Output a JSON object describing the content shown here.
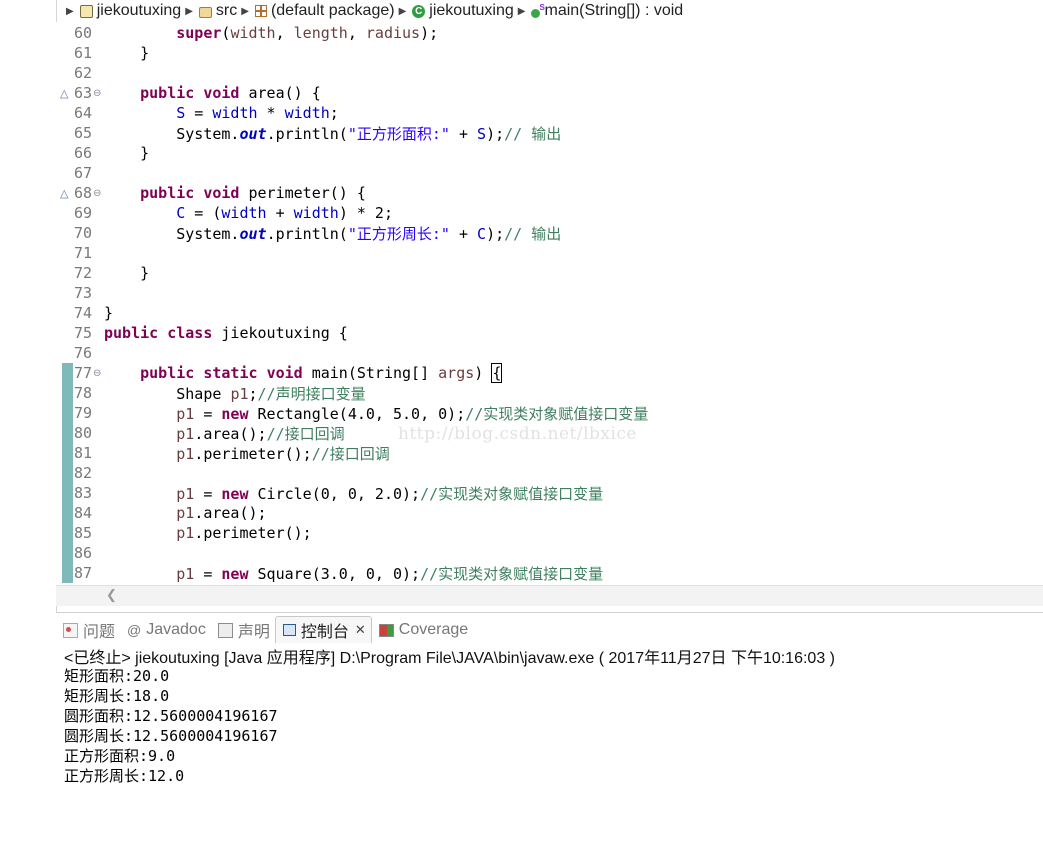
{
  "breadcrumb": {
    "project": "jiekoutuxing",
    "folder": "src",
    "package": "(default package)",
    "class": "jiekoutuxing",
    "method": "main(String[]) : void"
  },
  "editor": {
    "lines": [
      {
        "num": "60",
        "html": "        <span class=\"kw\">super</span>(<span class=\"var\">width</span>, <span class=\"var\">length</span>, <span class=\"var\">radius</span>);"
      },
      {
        "num": "61",
        "html": "    }"
      },
      {
        "num": "62",
        "html": ""
      },
      {
        "num": "63",
        "html": "    <span class=\"kw\">public</span> <span class=\"kw\">void</span> area() {",
        "mark": "override"
      },
      {
        "num": "64",
        "html": "        <span class=\"fld\">S</span> = <span class=\"fld\">width</span> * <span class=\"fld\">width</span>;"
      },
      {
        "num": "65",
        "html": "        System.<span class=\"st\">out</span>.println(<span class=\"str\">\"正方形面积:\"</span> + <span class=\"fld\">S</span>);<span class=\"cm\">// 输出</span>"
      },
      {
        "num": "66",
        "html": "    }"
      },
      {
        "num": "67",
        "html": ""
      },
      {
        "num": "68",
        "html": "    <span class=\"kw\">public</span> <span class=\"kw\">void</span> perimeter() {",
        "mark": "override"
      },
      {
        "num": "69",
        "html": "        <span class=\"fld\">C</span> = (<span class=\"fld\">width</span> + <span class=\"fld\">width</span>) * 2;"
      },
      {
        "num": "70",
        "html": "        System.<span class=\"st\">out</span>.println(<span class=\"str\">\"正方形周长:\"</span> + <span class=\"fld\">C</span>);<span class=\"cm\">// 输出</span>"
      },
      {
        "num": "71",
        "html": ""
      },
      {
        "num": "72",
        "html": "    }"
      },
      {
        "num": "73",
        "html": ""
      },
      {
        "num": "74",
        "html": "}"
      },
      {
        "num": "75",
        "html": "<span class=\"kw\">public</span> <span class=\"kw\">class</span> jiekoutuxing {"
      },
      {
        "num": "76",
        "html": ""
      },
      {
        "num": "77",
        "html": "    <span class=\"kw\">public</span> <span class=\"kw\">static</span> <span class=\"kw\">void</span> main(String[] <span class=\"var\">args</span>) <span class=\"cursor-box\">{</span>",
        "bar": true,
        "mark": "fold"
      },
      {
        "num": "78",
        "html": "        Shape <span class=\"var\">p1</span>;<span class=\"cm\">//声明接口变量</span>",
        "bar": true
      },
      {
        "num": "79",
        "html": "        <span class=\"var\">p1</span> = <span class=\"kw\">new</span> Rectangle(4.0, 5.0, 0);<span class=\"cm\">//实现类对象赋值接口变量</span>",
        "bar": true
      },
      {
        "num": "80",
        "html": "        <span class=\"var\">p1</span>.area();<span class=\"cm\">//接口回调</span>",
        "bar": true
      },
      {
        "num": "81",
        "html": "        <span class=\"var\">p1</span>.perimeter();<span class=\"cm\">//接口回调</span>",
        "bar": true
      },
      {
        "num": "82",
        "html": "",
        "bar": true
      },
      {
        "num": "83",
        "html": "        <span class=\"var\">p1</span> = <span class=\"kw\">new</span> Circle(0, 0, 2.0);<span class=\"cm\">//实现类对象赋值接口变量</span>",
        "bar": true
      },
      {
        "num": "84",
        "html": "        <span class=\"var\">p1</span>.area();",
        "bar": true
      },
      {
        "num": "85",
        "html": "        <span class=\"var\">p1</span>.perimeter();",
        "bar": true
      },
      {
        "num": "86",
        "html": "",
        "bar": true
      },
      {
        "num": "87",
        "html": "        <span class=\"var\">p1</span> = <span class=\"kw\">new</span> Square(3.0, 0, 0);<span class=\"cm\">//实现类对象赋值接口变量</span>",
        "bar": true
      }
    ],
    "watermark": "http://blog.csdn.net/lbxice"
  },
  "tabs": {
    "problems": "问题",
    "javadoc": "Javadoc",
    "declaration": "声明",
    "console": "控制台",
    "console_close": "✕",
    "coverage": "Coverage"
  },
  "console": {
    "header": "<已终止> jiekoutuxing [Java 应用程序] D:\\Program File\\JAVA\\bin\\javaw.exe ( 2017年11月27日 下午10:16:03 )",
    "output": [
      "矩形面积:20.0",
      "矩形周长:18.0",
      "圆形面积:12.5600004196167",
      "圆形周长:12.5600004196167",
      "正方形面积:9.0",
      "正方形周长:12.0"
    ]
  },
  "colors": {
    "keyword": "#7f0055",
    "field": "#0000c0",
    "string": "#2a00ff",
    "comment": "#3f7f5f",
    "gutter_bar": "#7fb9b9"
  }
}
